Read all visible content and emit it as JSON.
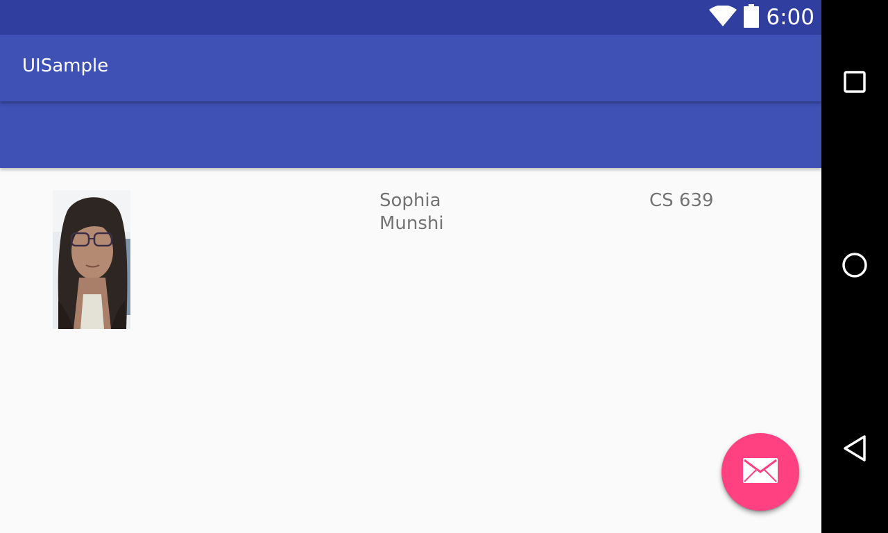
{
  "status_bar": {
    "time": "6:00",
    "icons": [
      "wifi-icon",
      "battery-icon"
    ],
    "color": "#303f9f"
  },
  "app_bar": {
    "title": "UISample",
    "color": "#3f51b5"
  },
  "profile": {
    "photo_icon": "profile-photo",
    "first_name": "Sophia",
    "last_name": "Munshi",
    "course": "CS 639"
  },
  "fab": {
    "icon": "mail-icon",
    "color": "#ff4081"
  },
  "nav_bar": {
    "buttons": [
      "recents-square-icon",
      "home-circle-icon",
      "back-triangle-icon"
    ]
  }
}
